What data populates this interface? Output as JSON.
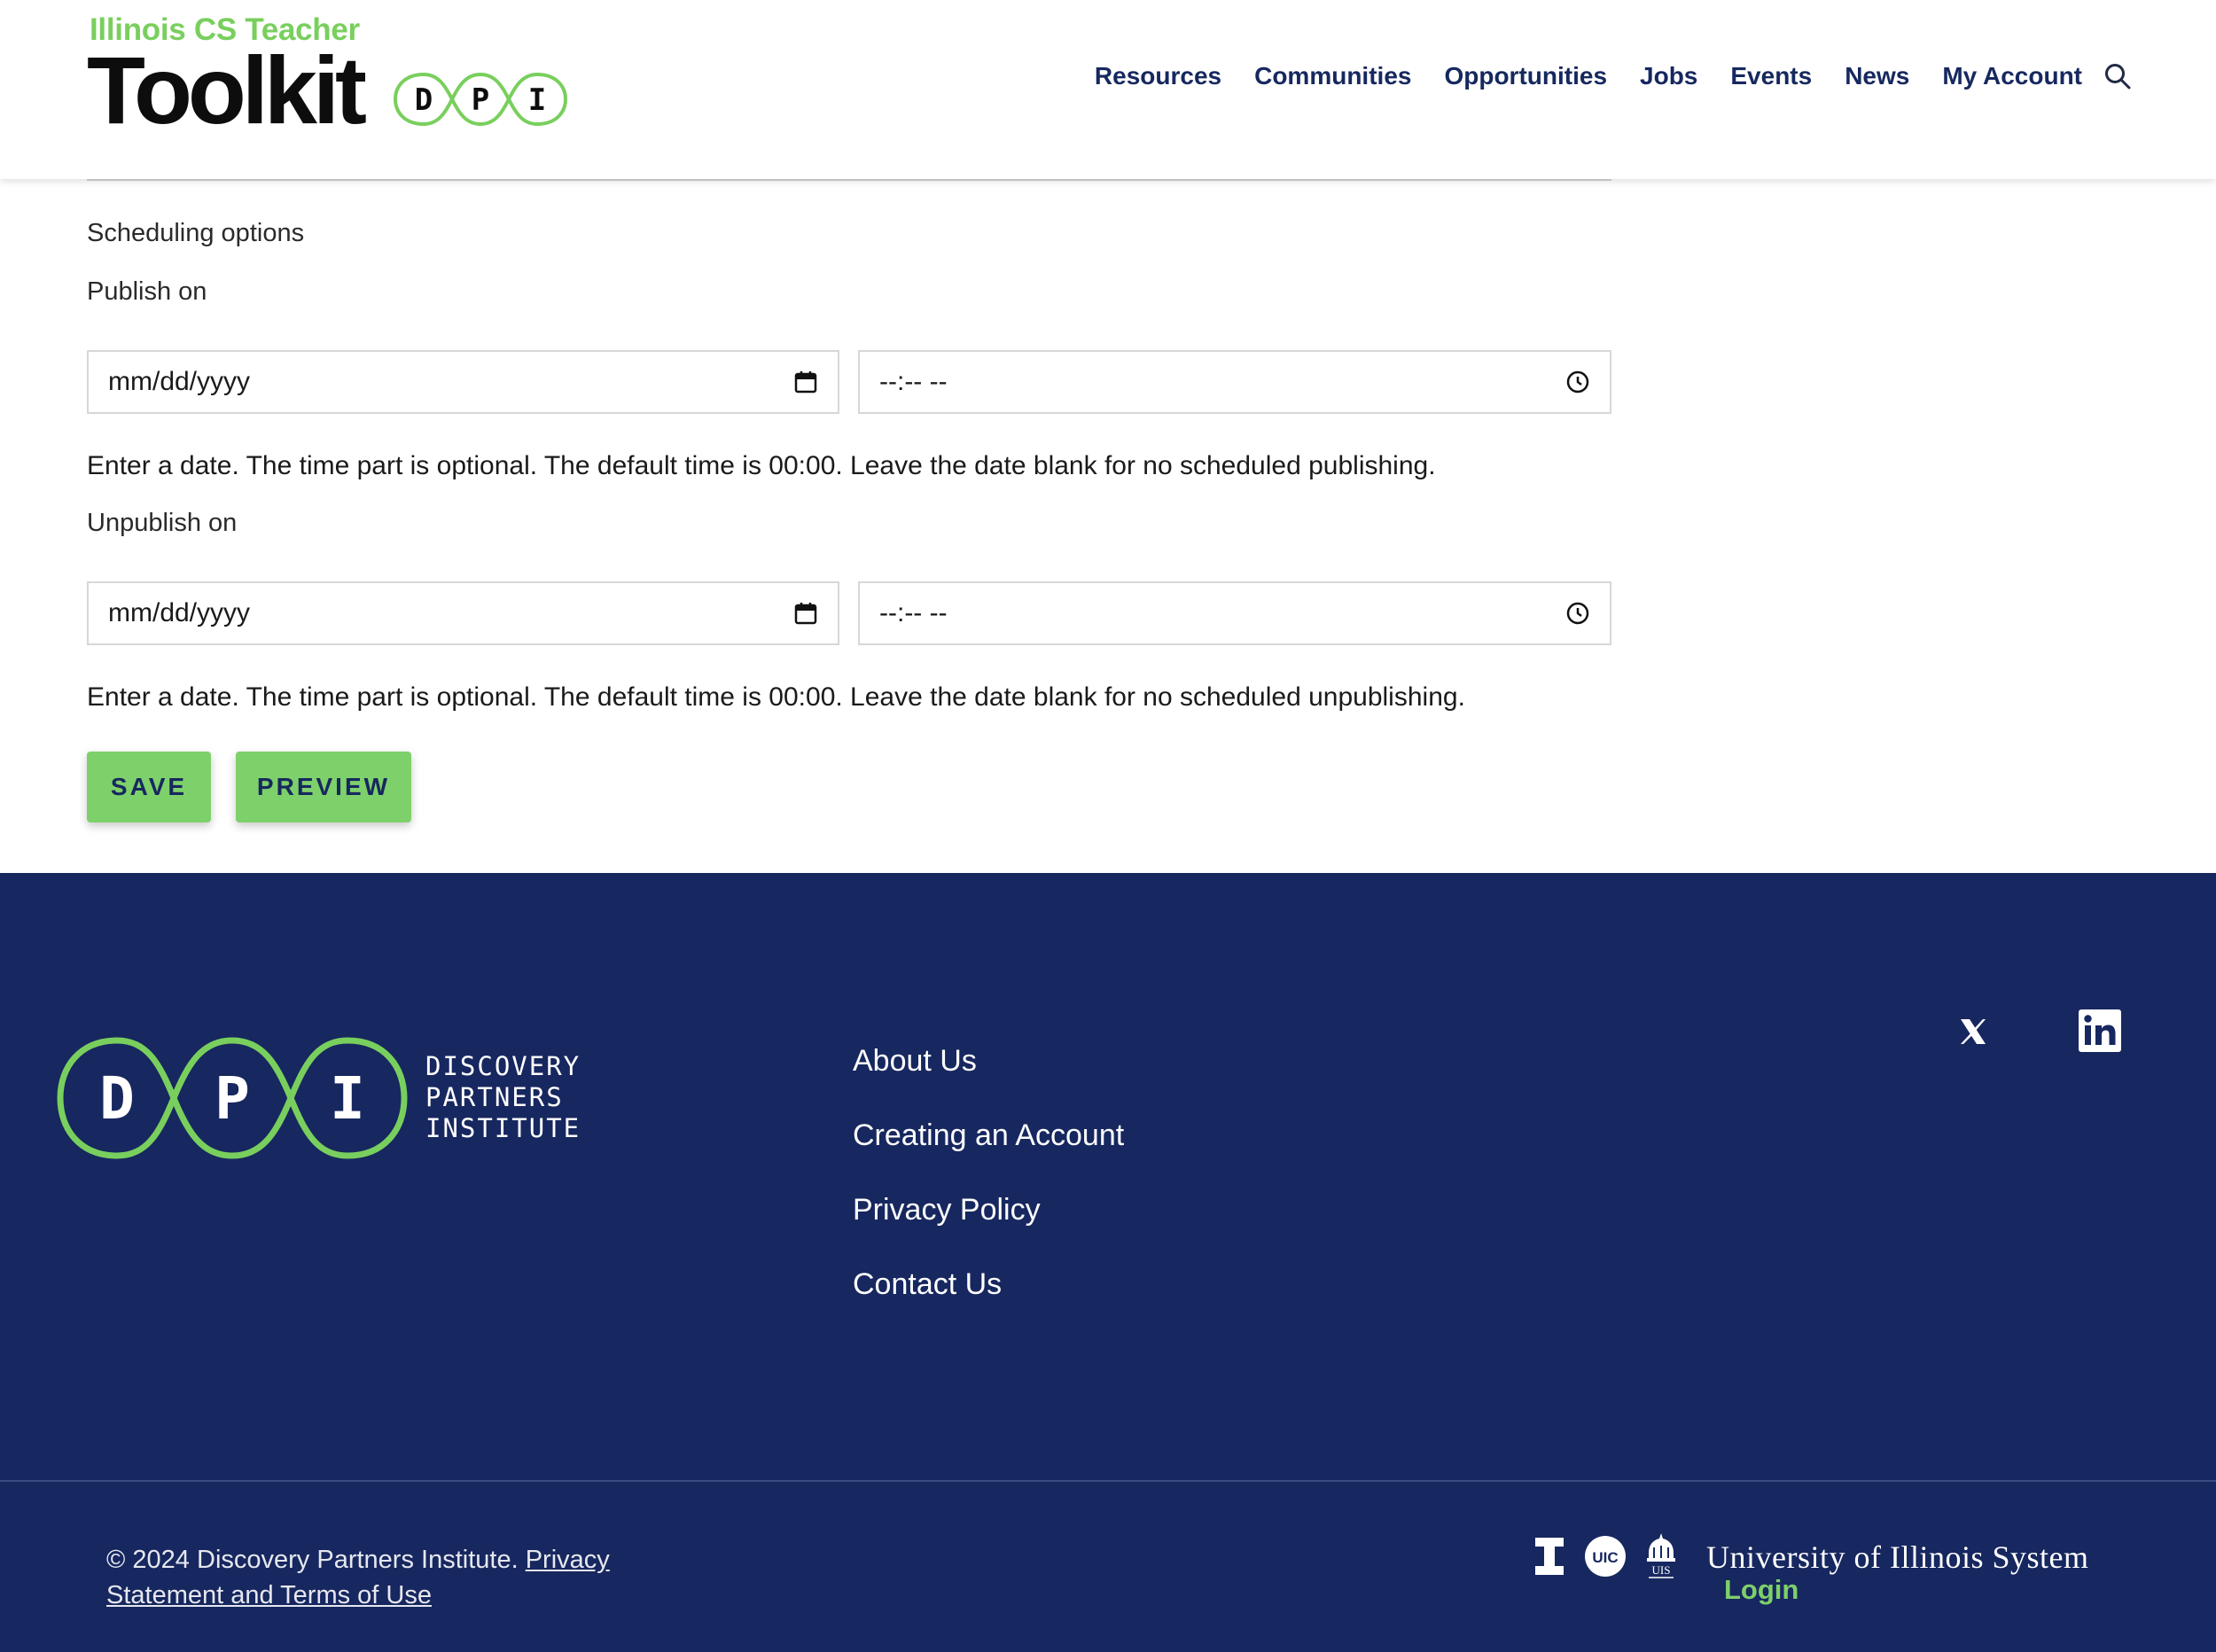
{
  "header": {
    "brand_sub": "Illinois CS Teacher",
    "brand_main": "Toolkit",
    "brand_logo_letters": [
      "D",
      "P",
      "I"
    ],
    "nav": [
      {
        "label": "Resources"
      },
      {
        "label": "Communities"
      },
      {
        "label": "Opportunities"
      },
      {
        "label": "Jobs"
      },
      {
        "label": "Events"
      },
      {
        "label": "News"
      },
      {
        "label": "My Account"
      }
    ],
    "search_icon": "search-icon"
  },
  "form": {
    "scheduling_title": "Scheduling options",
    "publish": {
      "label": "Publish on",
      "date_placeholder": "mm/dd/yyyy",
      "time_placeholder": "--:-- --",
      "help": "Enter a date. The time part is optional. The default time is 00:00. Leave the date blank for no scheduled publishing."
    },
    "unpublish": {
      "label": "Unpublish on",
      "date_placeholder": "mm/dd/yyyy",
      "time_placeholder": "--:-- --",
      "help": "Enter a date. The time part is optional. The default time is 00:00. Leave the date blank for no scheduled unpublishing."
    },
    "buttons": {
      "save": "SAVE",
      "preview": "PREVIEW"
    }
  },
  "footer": {
    "logo_letters": [
      "D",
      "P",
      "I"
    ],
    "org_lines": [
      "DISCOVERY",
      "PARTNERS",
      "INSTITUTE"
    ],
    "links": [
      {
        "label": "About Us"
      },
      {
        "label": "Creating an Account"
      },
      {
        "label": "Privacy Policy"
      },
      {
        "label": "Contact Us"
      }
    ],
    "social": [
      "x-icon",
      "linkedin-icon"
    ],
    "copyright_prefix": "© 2024 Discovery Partners Institute.",
    "copyright_link": "Privacy Statement and Terms of Use",
    "university_name": "University of Illinois System",
    "university_seal_labels": [
      "UIC",
      "UIS"
    ],
    "login": "Login"
  },
  "colors": {
    "navy": "#17275f",
    "green": "#7ed06a",
    "nav_text": "#16285e"
  }
}
